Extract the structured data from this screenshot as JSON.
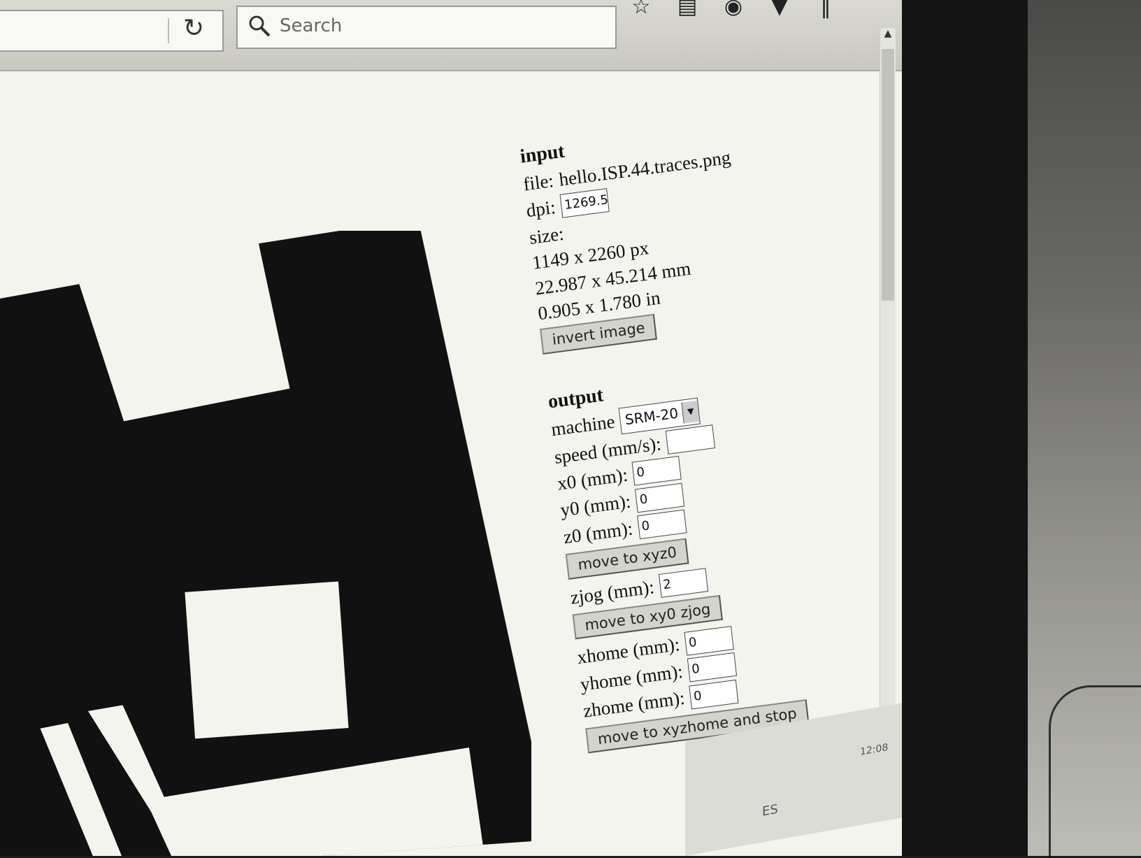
{
  "toolbar": {
    "search_placeholder": "Search",
    "icons": [
      "reload-icon",
      "star-icon",
      "reading-list-icon",
      "pocket-icon",
      "download-icon",
      "menu-icon"
    ]
  },
  "input": {
    "heading": "input",
    "file_label": "file:",
    "file_name": "hello.ISP.44.traces.png",
    "dpi_label": "dpi:",
    "dpi_value": "1269.5",
    "size_label": "size:",
    "size_px": "1149 x 2260 px",
    "size_mm": "22.987 x 45.214 mm",
    "size_in": "0.905 x 1.780 in",
    "invert_button": "invert image"
  },
  "output": {
    "heading": "output",
    "machine_label": "machine",
    "machine_value": "SRM-20",
    "speed_label": "speed (mm/s):",
    "speed_value": "",
    "x0_label": "x0 (mm):",
    "x0_value": "0",
    "y0_label": "y0 (mm):",
    "y0_value": "0",
    "z0_label": "z0 (mm):",
    "z0_value": "0",
    "move_xyz0_button": "move to xyz0",
    "zjog_label": "zjog (mm):",
    "zjog_value": "2",
    "move_xy0_zjog_button": "move to xy0 zjog",
    "xhome_label": "xhome (mm):",
    "xhome_value": "0",
    "yhome_label": "yhome (mm):",
    "yhome_value": "0",
    "zhome_label": "zhome (mm):",
    "zhome_value": "0",
    "move_home_button": "move to xyzhome and stop"
  },
  "taskbar": {
    "language": "ES",
    "time": "12:08"
  },
  "colors": {
    "page_background": "#f4f4ef",
    "trace_black": "#111111",
    "toolbar": "#d0d0c8"
  }
}
